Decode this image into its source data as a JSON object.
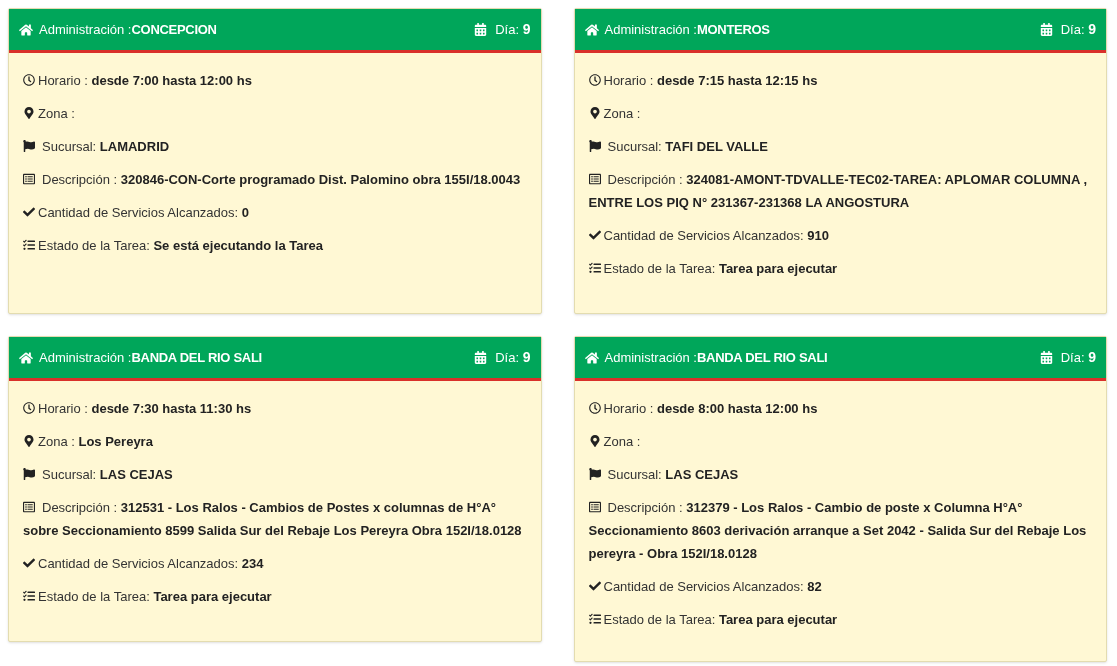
{
  "cards": [
    {
      "admin": {
        "label": "Administración :",
        "value": "CONCEPCION"
      },
      "day": {
        "label": "Día:",
        "value": "9"
      },
      "fields": [
        {
          "kind": "schedule",
          "label": "Horario : ",
          "value": "desde 7:00 hasta 12:00 hs"
        },
        {
          "kind": "zone",
          "label": "Zona : "
        },
        {
          "kind": "branch",
          "label": "Sucursal: ",
          "value": "LAMADRID"
        },
        {
          "kind": "description",
          "label": "Descripción : ",
          "value": "320846-CON-Corte programado Dist. Palomino obra 155I/18.0043"
        },
        {
          "kind": "services",
          "label": "Cantidad de Servicios Alcanzados: ",
          "value": "0"
        },
        {
          "kind": "status",
          "label": "Estado de la Tarea: ",
          "value": "Se está ejecutando la Tarea"
        }
      ]
    },
    {
      "admin": {
        "label": "Administración :",
        "value": "MONTEROS"
      },
      "day": {
        "label": "Día:",
        "value": "9"
      },
      "fields": [
        {
          "kind": "schedule",
          "label": "Horario : ",
          "value": "desde 7:15 hasta 12:15 hs"
        },
        {
          "kind": "zone",
          "label": "Zona : "
        },
        {
          "kind": "branch",
          "label": "Sucursal: ",
          "value": "TAFI DEL VALLE"
        },
        {
          "kind": "description",
          "label": "Descripción : ",
          "value": "324081-AMONT-TDVALLE-TEC02-TAREA: APLOMAR COLUMNA , ENTRE LOS PIQ N° 231367-231368 LA ANGOSTURA"
        },
        {
          "kind": "services",
          "label": "Cantidad de Servicios Alcanzados: ",
          "value": "910"
        },
        {
          "kind": "status",
          "label": "Estado de la Tarea: ",
          "value": "Tarea para ejecutar"
        }
      ]
    },
    {
      "admin": {
        "label": "Administración :",
        "value": "BANDA DEL RIO SALI"
      },
      "day": {
        "label": "Día:",
        "value": "9"
      },
      "fields": [
        {
          "kind": "schedule",
          "label": "Horario : ",
          "value": "desde 7:30 hasta 11:30 hs"
        },
        {
          "kind": "zone",
          "label": "Zona : ",
          "value": "Los Pereyra"
        },
        {
          "kind": "branch",
          "label": "Sucursal: ",
          "value": "LAS CEJAS"
        },
        {
          "kind": "description",
          "label": "Descripción : ",
          "value": "312531 - Los Ralos - Cambios de Postes x columnas de H°A° sobre Seccionamiento 8599 Salida Sur del Rebaje Los Pereyra Obra 152I/18.0128"
        },
        {
          "kind": "services",
          "label": "Cantidad de Servicios Alcanzados: ",
          "value": "234"
        },
        {
          "kind": "status",
          "label": "Estado de la Tarea: ",
          "value": "Tarea para ejecutar"
        }
      ]
    },
    {
      "admin": {
        "label": "Administración :",
        "value": "BANDA DEL RIO SALI"
      },
      "day": {
        "label": "Día:",
        "value": "9"
      },
      "fields": [
        {
          "kind": "schedule",
          "label": "Horario : ",
          "value": "desde 8:00 hasta 12:00 hs"
        },
        {
          "kind": "zone",
          "label": "Zona : "
        },
        {
          "kind": "branch",
          "label": "Sucursal: ",
          "value": "LAS CEJAS"
        },
        {
          "kind": "description",
          "label": "Descripción : ",
          "value": "312379 - Los Ralos - Cambio de poste x Columna H°A° Seccionamiento 8603 derivación arranque a Set 2042 - Salida Sur del Rebaje Los pereyra - Obra 152I/18.0128"
        },
        {
          "kind": "services",
          "label": "Cantidad de Servicios Alcanzados: ",
          "value": "82"
        },
        {
          "kind": "status",
          "label": "Estado de la Tarea: ",
          "value": "Tarea para ejecutar"
        }
      ]
    }
  ]
}
